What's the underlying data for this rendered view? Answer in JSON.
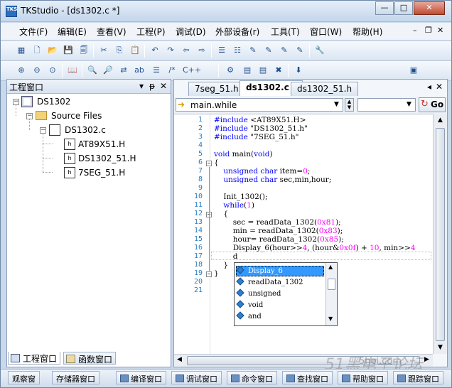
{
  "window": {
    "title": "TKStudio - [ds1302.c *]"
  },
  "caption": {
    "minimize": "—",
    "maximize": "□",
    "close": "✕"
  },
  "menu": {
    "items": [
      "文件(F)",
      "编辑(E)",
      "查看(V)",
      "工程(P)",
      "调试(D)",
      "外部设备(r)",
      "工具(T)",
      "窗口(W)",
      "帮助(H)"
    ],
    "mdi_minimize": "–",
    "mdi_restore": "❐",
    "mdi_close": "✕"
  },
  "left_panel": {
    "title": "工程窗口",
    "pin": "ᵽ",
    "dropdown": "▾",
    "close": "✕",
    "tree": {
      "project": "DS1302",
      "folder": "Source Files",
      "file": "DS1302.c",
      "headers": [
        "AT89X51.H",
        "DS1302_51.H",
        "7SEG_51.H"
      ]
    },
    "tabs": {
      "project": "工程窗口",
      "functions": "函数窗口"
    }
  },
  "editor": {
    "tabs": [
      "7seg_51.h",
      "ds1302.c *",
      "ds1302_51.h"
    ],
    "active_tab": "ds1302.c *",
    "function_nav": "main.while",
    "go_label": "Go",
    "lines": [
      "#include <AT89X51.H>",
      "#include \"DS1302_51.h\"",
      "#include \"7SEG_51.h\"",
      "",
      "void main(void)",
      "{",
      "    unsigned char item=0;",
      "    unsigned char sec,min,hour;",
      "",
      "    Init_1302();",
      "    while(1)",
      "    {",
      "        sec = readData_1302(0x81);",
      "        min = readData_1302(0x83);",
      "        hour= readData_1302(0x85);",
      "        Display_6(hour>>4, (hour&0x0f) + 10, min>>4",
      "        d",
      "    }",
      "}",
      "",
      ""
    ]
  },
  "autocomplete": {
    "items": [
      "Display_6",
      "readData_1302",
      "unsigned",
      "void",
      "and"
    ],
    "selected": "Display_6"
  },
  "statusbar": {
    "tabs": [
      "观察窗",
      "存储器窗口",
      "编译窗口",
      "调试窗口",
      "命令窗口",
      "查找窗口",
      "帮助窗口",
      "跟踪窗口"
    ]
  },
  "watermark": {
    "line1": "51黑电子论坛",
    "line2": "5hei.com"
  },
  "colors": {
    "keyword": "#0000ff",
    "number": "#ff00ff",
    "line_number": "#2b7dbf",
    "selection": "#3399ff"
  }
}
